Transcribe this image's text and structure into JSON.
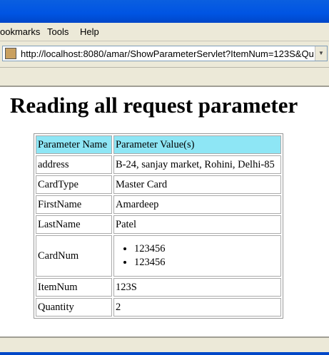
{
  "menu": [
    "ookmarks",
    "Tools",
    "Help"
  ],
  "address": {
    "url": "http://localhost:8080/amar/ShowParameterServlet?ItemNum=123S&Qu"
  },
  "page": {
    "title": "Reading all request parameter",
    "headers": [
      "Parameter Name",
      "Parameter Value(s)"
    ],
    "rows": [
      {
        "name": "address",
        "value": "B-24, sanjay market, Rohini, Delhi-85"
      },
      {
        "name": "CardType",
        "value": "Master Card"
      },
      {
        "name": "FirstName",
        "value": "Amardeep"
      },
      {
        "name": "LastName",
        "value": "Patel"
      },
      {
        "name": "CardNum",
        "values": [
          "123456",
          "123456"
        ]
      },
      {
        "name": "ItemNum",
        "value": "123S"
      },
      {
        "name": "Quantity",
        "value": "2"
      }
    ]
  }
}
